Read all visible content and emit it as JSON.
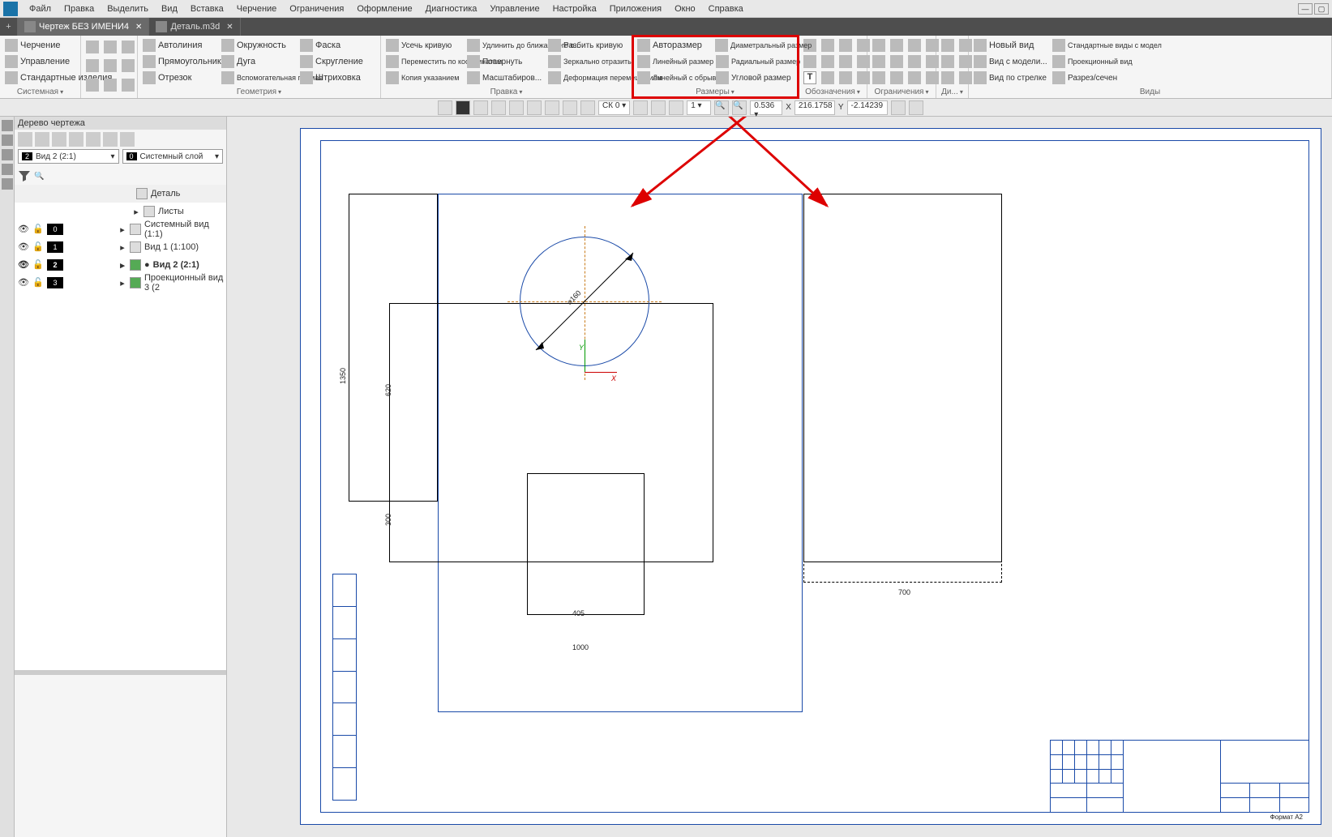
{
  "menu": [
    "Файл",
    "Правка",
    "Выделить",
    "Вид",
    "Вставка",
    "Черчение",
    "Ограничения",
    "Оформление",
    "Диагностика",
    "Управление",
    "Настройка",
    "Приложения",
    "Окно",
    "Справка"
  ],
  "tabs": [
    {
      "label": "Чертеж БЕЗ ИМЕНИ4",
      "active": true
    },
    {
      "label": "Деталь.m3d",
      "active": false
    }
  ],
  "ribbon": {
    "g1": {
      "items": [
        "Черчение",
        "Управление",
        "Стандартные изделия"
      ],
      "label": "Системная"
    },
    "g2": {
      "label": ""
    },
    "geom": {
      "label": "Геометрия",
      "items": [
        "Автолиния",
        "Окружность",
        "Фаска",
        "Прямоугольник",
        "Дуга",
        "Скругление",
        "Отрезок",
        "Вспомогательная прямая",
        "Штриховка"
      ]
    },
    "edit": {
      "label": "Правка",
      "items": [
        "Усечь кривую",
        "Удлинить до ближайшего о...",
        "Разбить кривую",
        "Переместить по координатам",
        "Повернуть",
        "Зеркально отразить",
        "Копия указанием",
        "Масштабиров...",
        "Деформация перемещением"
      ]
    },
    "dims": {
      "label": "Размеры",
      "items": [
        "Авторазмер",
        "Диаметральный размер",
        "Линейный размер",
        "Радиальный размер",
        "Линейный с обрывом",
        "Угловой размер"
      ]
    },
    "annot": {
      "label": "Обозначения"
    },
    "constr": {
      "label": "Ограничения"
    },
    "diag": {
      "label": "Ди..."
    },
    "views": {
      "label": "Виды",
      "items": [
        "Новый вид",
        "Стандартные виды с модел",
        "Вид с модели...",
        "Проекционный вид",
        "Вид по стрелке",
        "Разрез/сечен"
      ]
    }
  },
  "viewbar": {
    "sk": "СК 0",
    "step": "1",
    "zoom": "0.536",
    "x_label": "X",
    "x": "216.1758",
    "y_label": "Y",
    "y": "-2.14239"
  },
  "leftpanel": {
    "title": "Дерево чертежа",
    "viewCombo": {
      "badge": "2",
      "text": "Вид 2 (2:1)"
    },
    "layerCombo": {
      "badge": "0",
      "text": "Системный слой"
    },
    "header": "Деталь",
    "rows": [
      {
        "type": "node",
        "label": "Листы"
      },
      {
        "type": "leaf",
        "num": "0",
        "label": "Системный вид (1:1)"
      },
      {
        "type": "leaf",
        "num": "1",
        "label": "Вид 1 (1:100)"
      },
      {
        "type": "leaf",
        "num": "2",
        "label": "Вид 2 (2:1)",
        "bold": true
      },
      {
        "type": "leaf",
        "num": "3",
        "label": "Проекционный вид 3 (2"
      }
    ]
  },
  "drawing": {
    "dim_diameter": "⌀160",
    "dim_1350": "1350",
    "dim_620": "620",
    "dim_300": "300",
    "dim_405": "405",
    "dim_1000": "1000",
    "dim_700": "700",
    "axis_x": "X",
    "axis_y": "Y",
    "titleblock_format": "Формат  А2"
  }
}
